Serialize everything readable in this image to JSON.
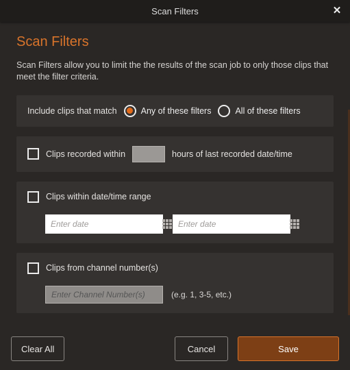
{
  "titlebar": {
    "title": "Scan Filters"
  },
  "header": {
    "heading": "Scan Filters",
    "description": "Scan Filters allow you to limit the the results of the scan job to only those clips that meet the filter criteria."
  },
  "match": {
    "label": "Include clips that match",
    "options": [
      {
        "label": "Any of these filters",
        "selected": true
      },
      {
        "label": "All of these filters",
        "selected": false
      }
    ]
  },
  "recorded_within": {
    "checkbox_label": "Clips recorded within",
    "checked": false,
    "hours_value": "",
    "suffix_label": "hours of last recorded date/time"
  },
  "date_range": {
    "checkbox_label": "Clips within date/time range",
    "checked": false,
    "from_placeholder": "Enter date",
    "from_value": "",
    "to_placeholder": "Enter date",
    "to_value": ""
  },
  "channels": {
    "checkbox_label": "Clips from channel number(s)",
    "checked": false,
    "placeholder": "Enter Channel Number(s)",
    "value": "",
    "hint": "(e.g.  1, 3-5, etc.)"
  },
  "footer": {
    "clear_all": "Clear All",
    "cancel": "Cancel",
    "save": "Save"
  }
}
